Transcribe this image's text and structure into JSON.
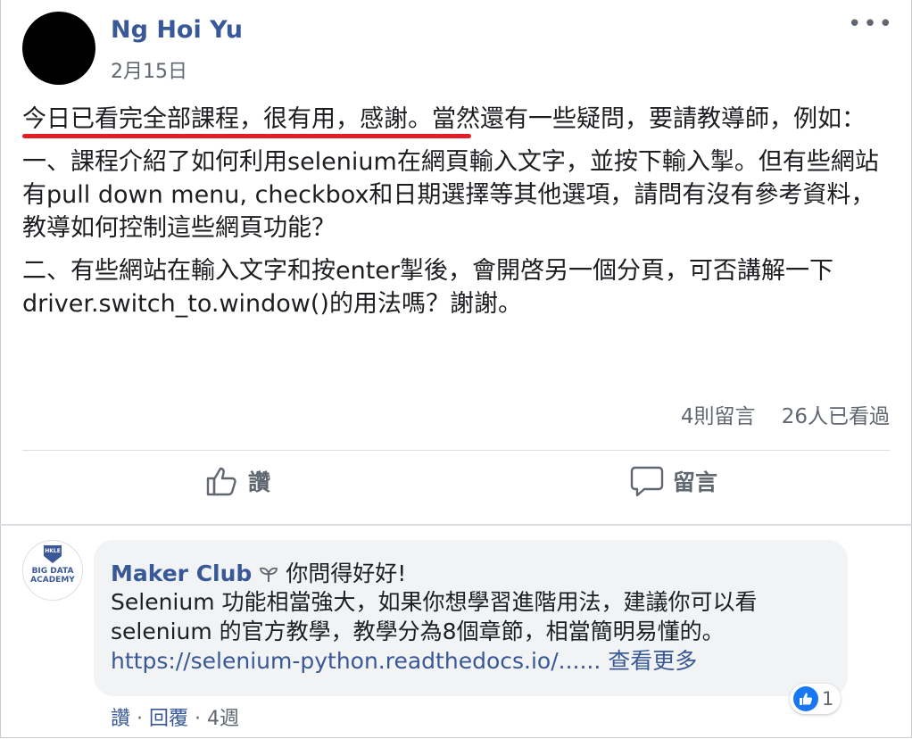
{
  "post": {
    "author": "Ng Hoi Yu",
    "date": "2月15日",
    "menu_icon": "more-dots-icon",
    "paragraphs": [
      "今日已看完全部課程，很有用，感謝。當然還有一些疑問，要請教導師，例如：",
      "一、課程介紹了如何利用selenium在網頁輸入文字，並按下輸入掣。但有些網站有pull down menu, checkbox和日期選擇等其他選項，請問有沒有參考資料，教導如何控制這些網頁功能？",
      "二、有些網站在輸入文字和按enter掣後，會開啓另一個分頁，可否講解一下driver.switch_to.window()的用法嗎？謝謝。"
    ],
    "highlight_color": "#e41e26",
    "stats": {
      "comments": "4則留言",
      "views": "26人已看過"
    },
    "actions": {
      "like_label": "讚",
      "comment_label": "留言"
    }
  },
  "comment": {
    "avatar_badge": "HKLE",
    "avatar_text": "BIG DATA ACADEMY",
    "author": "Maker Club",
    "author_icon": "sprout-icon",
    "first_line": "你問得好好!",
    "text": "Selenium 功能相當強大，如果你想學習進階用法，建議你可以看selenium 的官方教學，教學分為8個章節，相當簡明易懂的。",
    "link": "https://selenium-python.readthedocs.io/......",
    "see_more": "查看更多",
    "reaction_count": "1",
    "footer": {
      "like": "讚",
      "reply": "回覆",
      "age": "4週"
    }
  },
  "colors": {
    "link": "#385898",
    "secondary": "#606770",
    "bubble": "#f2f3f5",
    "like_blue": "#1877f2"
  }
}
